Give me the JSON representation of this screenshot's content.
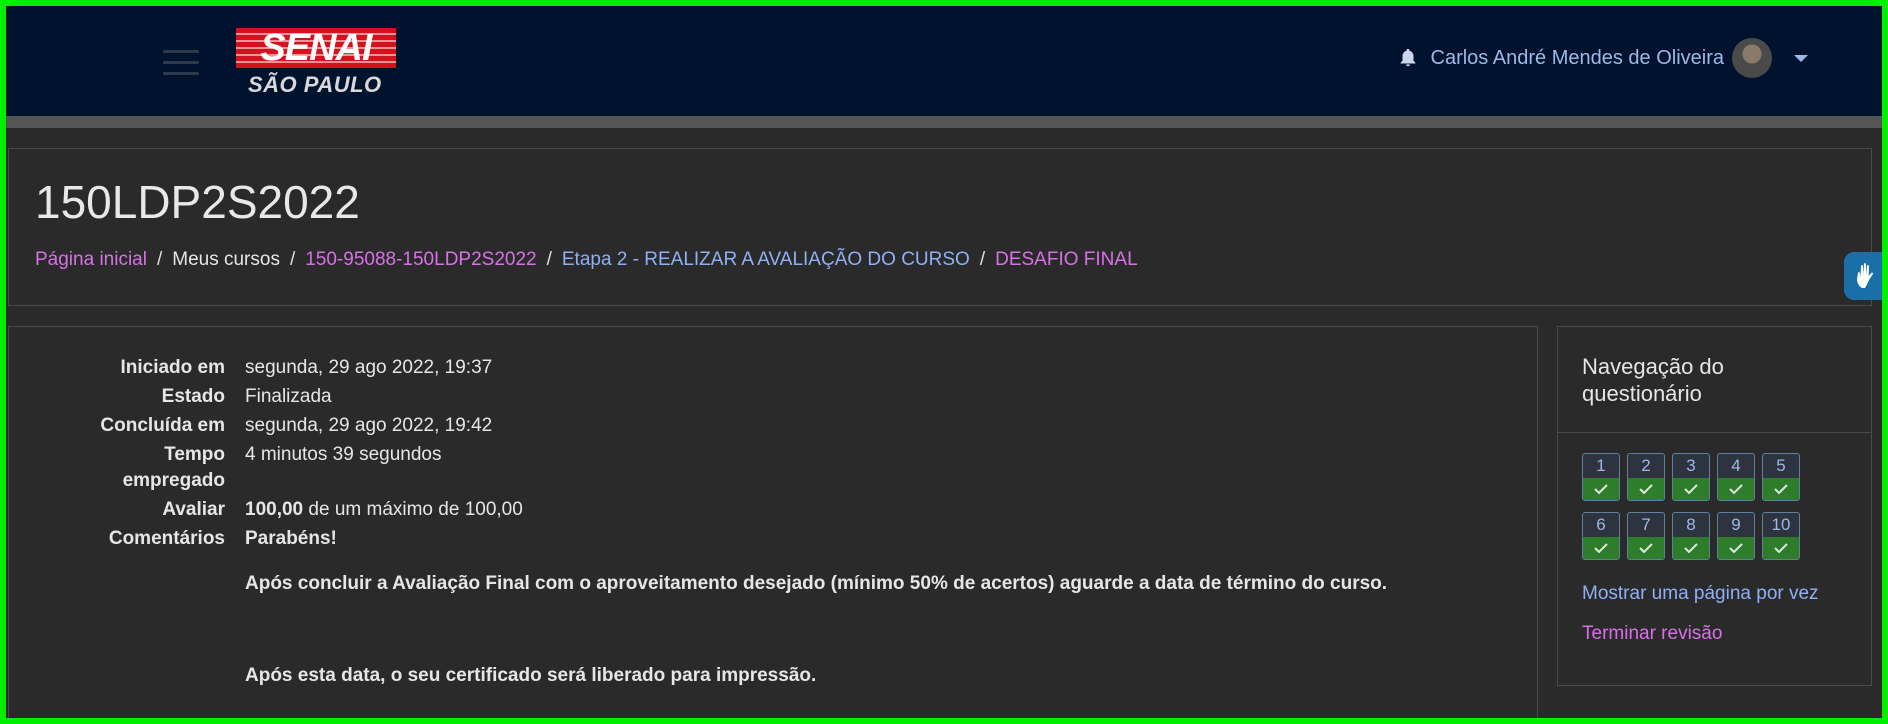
{
  "header": {
    "brand": "SENAI",
    "brand_sub": "SÃO PAULO",
    "user_name": "Carlos André Mendes de Oliveira",
    "icons": [
      "menu-icon",
      "bell-icon",
      "chevron-down-icon",
      "accessibility-icon"
    ]
  },
  "page": {
    "title": "150LDP2S2022",
    "breadcrumb": [
      {
        "label": "Página inicial",
        "color": "#d772e6"
      },
      {
        "label": "Meus cursos",
        "color": "#e6e6e6"
      },
      {
        "label": "150-95088-150LDP2S2022",
        "color": "#d772e6"
      },
      {
        "label": "Etapa 2 - REALIZAR A AVALIAÇÃO DO CURSO",
        "color": "#8fb0f5"
      },
      {
        "label": "DESAFIO FINAL",
        "color": "#d772e6"
      }
    ]
  },
  "summary": {
    "started_label": "Iniciado em",
    "started_value": "segunda, 29 ago 2022, 19:37",
    "state_label": "Estado",
    "state_value": "Finalizada",
    "completed_label": "Concluída em",
    "completed_value": "segunda, 29 ago 2022, 19:42",
    "time_label_1": "Tempo",
    "time_label_2": "empregado",
    "time_value": "4 minutos 39 segundos",
    "grade_label": "Avaliar",
    "grade_score": "100,00",
    "grade_rest": "de um máximo de 100,00",
    "feedback_label": "Comentários",
    "feedback_title": "Parabéns!",
    "feedback_p1": "Após concluir a Avaliação Final com o aproveitamento desejado (mínimo 50% de acertos) aguarde a data de término do curso.",
    "feedback_p2": "Após esta data, o seu certificado será liberado para impressão."
  },
  "quiz_nav": {
    "title": "Navegação do questionário",
    "questions": [
      {
        "num": "1",
        "status": "correct"
      },
      {
        "num": "2",
        "status": "correct"
      },
      {
        "num": "3",
        "status": "correct"
      },
      {
        "num": "4",
        "status": "correct"
      },
      {
        "num": "5",
        "status": "correct"
      },
      {
        "num": "6",
        "status": "correct"
      },
      {
        "num": "7",
        "status": "correct"
      },
      {
        "num": "8",
        "status": "correct"
      },
      {
        "num": "9",
        "status": "correct"
      },
      {
        "num": "10",
        "status": "correct"
      }
    ],
    "show_one_page": "Mostrar uma página por vez",
    "finish_review": "Terminar revisão"
  },
  "colors": {
    "navbar": "#00132e",
    "link_pink": "#d772e6",
    "link_blue": "#8fb0f5",
    "correct_green": "#2d7d2a",
    "frame": "#00ee00"
  }
}
